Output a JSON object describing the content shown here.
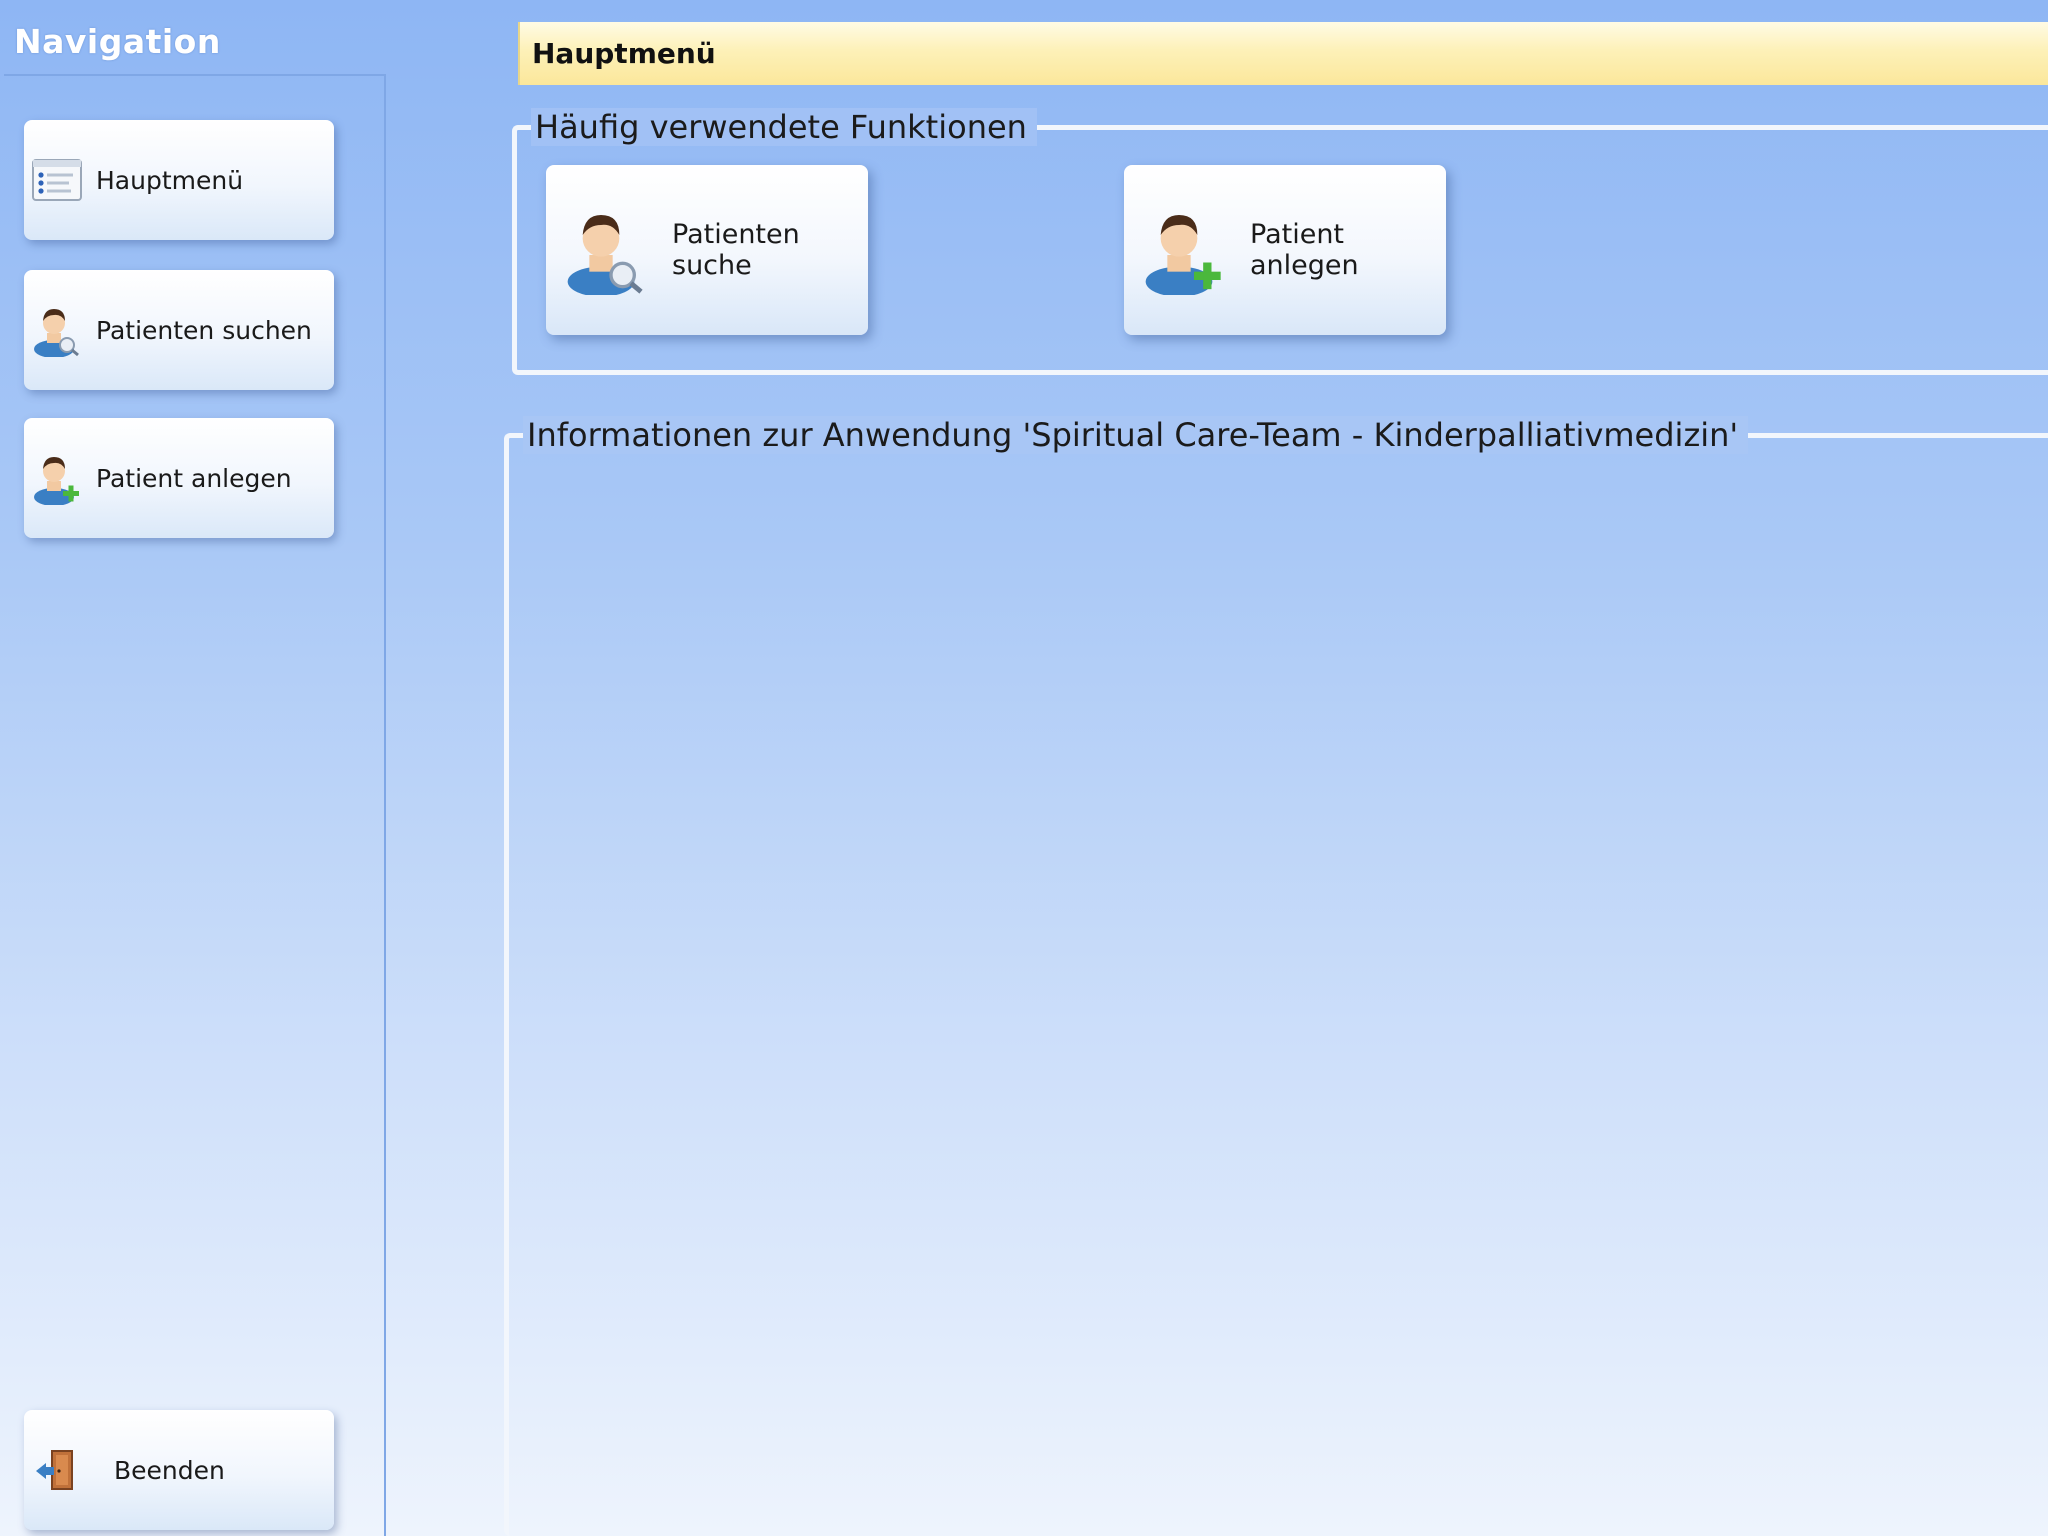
{
  "sidebar": {
    "title": "Navigation",
    "items": [
      {
        "label": "Hauptmenü",
        "icon": "list-icon"
      },
      {
        "label": "Patienten suchen",
        "icon": "person-search-icon"
      },
      {
        "label": "Patient anlegen",
        "icon": "person-add-icon"
      }
    ],
    "exit": {
      "label": "Beenden",
      "icon": "exit-door-icon"
    }
  },
  "header": {
    "title": "Hauptmenü"
  },
  "frequent": {
    "legend": "Häufig verwendete Funktionen",
    "buttons": [
      {
        "label": "Patienten suche",
        "icon": "person-search-icon"
      },
      {
        "label": "Patient anlegen",
        "icon": "person-add-icon"
      }
    ]
  },
  "info": {
    "legend": "Informationen zur  Anwendung 'Spiritual Care-Team - Kinderpalliativmedizin'"
  },
  "colors": {
    "header_accent": "#fbe79b",
    "background_top": "#8eb6f4",
    "background_bottom": "#eef4fd"
  }
}
